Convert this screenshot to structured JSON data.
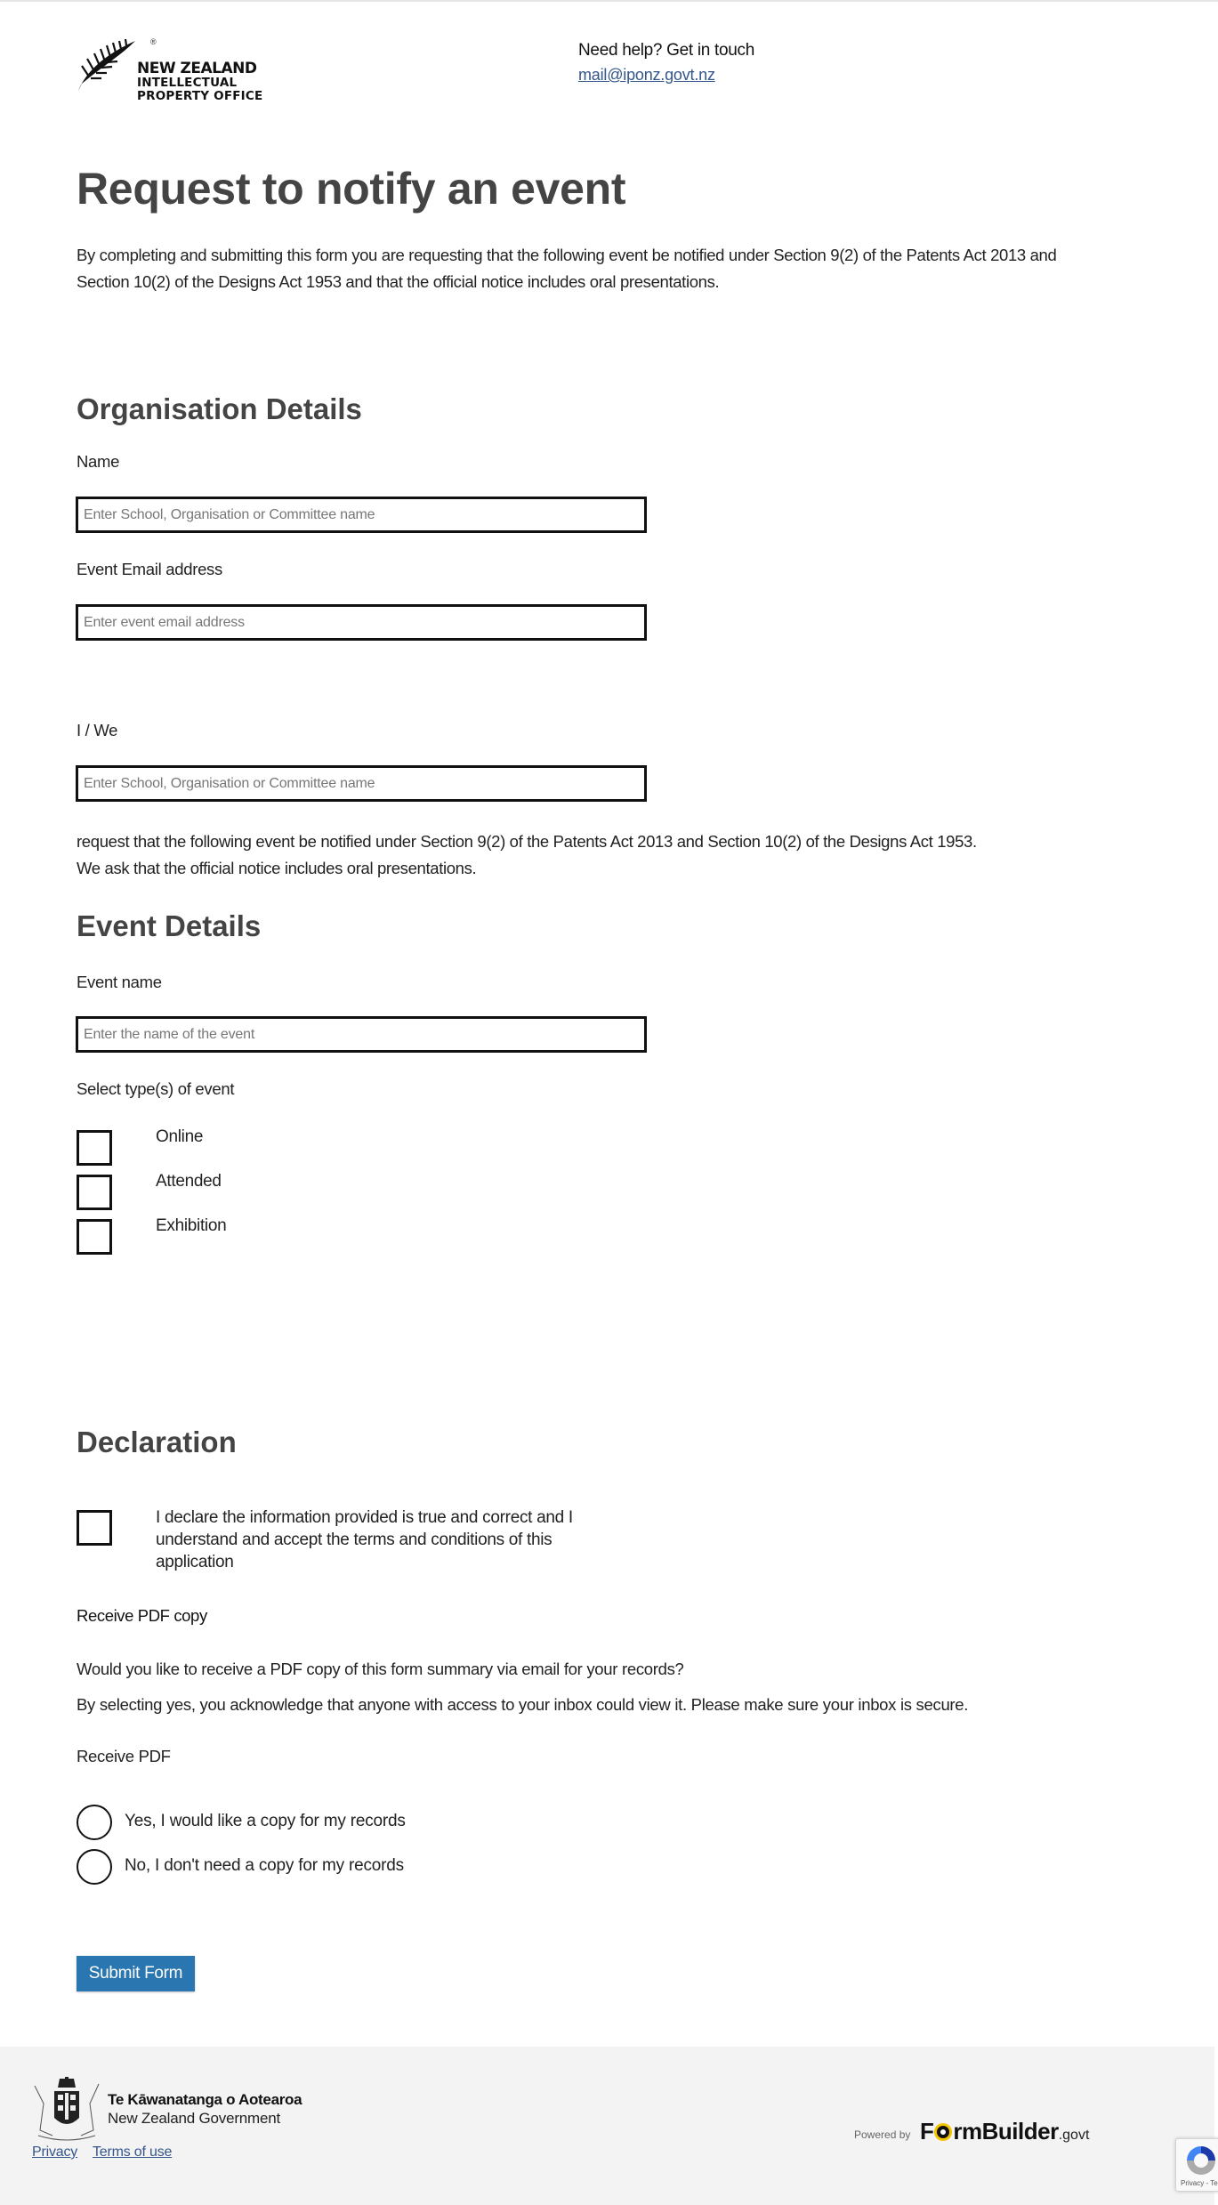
{
  "header": {
    "logo": {
      "line1": "NEW ZEALAND",
      "line2": "INTELLECTUAL",
      "line3": "PROPERTY OFFICE",
      "trademark": "®"
    },
    "help_title": "Need help? Get in touch",
    "help_email": "mail@iponz.govt.nz"
  },
  "page": {
    "title": "Request to notify an event",
    "intro": "By completing and submitting this form you are requesting that the following event be notified under Section 9(2) of the Patents Act 2013 and Section 10(2) of the Designs Act 1953 and that the official notice includes oral presentations."
  },
  "organisation": {
    "heading": "Organisation Details",
    "name_label": "Name",
    "name_placeholder": "Enter School, Organisation or Committee name",
    "name_value": "",
    "email_label": "Event Email address",
    "email_placeholder": "Enter event email address",
    "email_value": "",
    "iwe_label": "I / We",
    "iwe_placeholder": "Enter School, Organisation or Committee name",
    "iwe_value": "",
    "request_text_line1": "request that the following event be notified under Section 9(2) of the Patents Act 2013 and Section 10(2) of the Designs Act 1953.",
    "request_text_line2": "We ask that the official notice includes oral presentations."
  },
  "event": {
    "heading": "Event Details",
    "name_label": "Event name",
    "name_placeholder": "Enter the name of the event",
    "name_value": "",
    "types_label": "Select type(s) of event",
    "types": [
      {
        "label": "Online",
        "checked": false
      },
      {
        "label": "Attended",
        "checked": false
      },
      {
        "label": "Exhibition",
        "checked": false
      }
    ]
  },
  "declaration": {
    "heading": "Declaration",
    "checkbox_label": "I declare the information provided is true and correct and I understand and accept the terms and conditions of this application",
    "checked": false
  },
  "pdf": {
    "heading": "Receive PDF copy",
    "question": "Would you like to receive a PDF copy of this form summary via email for your records?",
    "notice": "By selecting yes, you acknowledge that anyone with access to your inbox could view it. Please make sure your inbox is secure.",
    "field_label": "Receive PDF",
    "options": [
      {
        "label": "Yes, I would like a copy for my records",
        "selected": false
      },
      {
        "label": "No, I don't need a copy for my records",
        "selected": false
      }
    ]
  },
  "submit_label": "Submit Form",
  "footer": {
    "gov_title": "Te Kāwanatanga o Aotearoa",
    "gov_subtitle": "New Zealand Government",
    "links": [
      "Privacy",
      "Terms of use"
    ],
    "powered_by": "Powered by",
    "formbuilder_pre": "F",
    "formbuilder_post": "rmBuilder",
    "formbuilder_suffix": ".govt",
    "recaptcha_text": "Privacy - Terms"
  },
  "colors": {
    "accent": "#2a76b0",
    "link": "#34568b",
    "heading": "#444444",
    "footer_bg": "#f3f3f3"
  }
}
